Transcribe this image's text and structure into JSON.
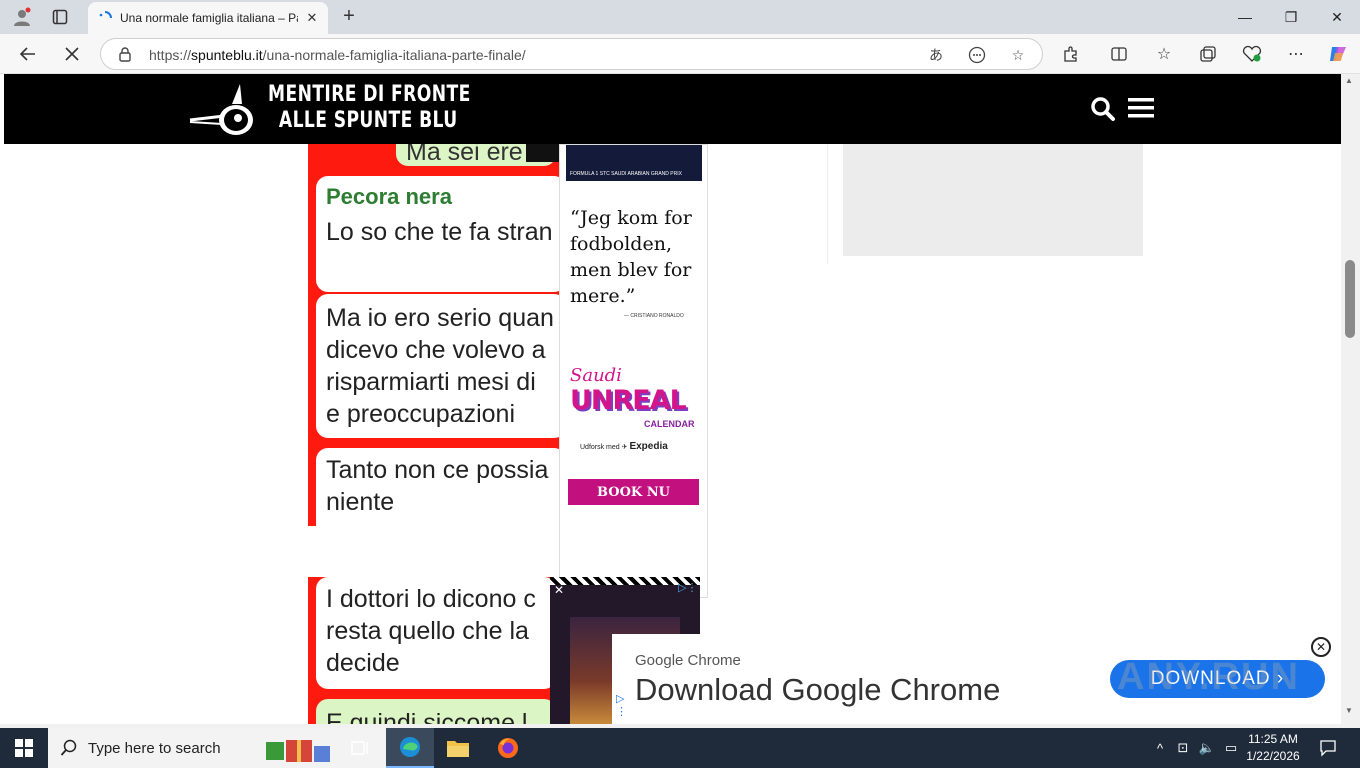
{
  "browser": {
    "tab_title": "Una normale famiglia italiana – Pa",
    "url_prefix": "https://",
    "url_host": "spunteblu.it",
    "url_path": "/una-normale-famiglia-italiana-parte-finale/",
    "window_controls": {
      "minimize": "—",
      "restore": "❐",
      "close": "✕"
    }
  },
  "site": {
    "logo_line1": "MENTIRE DI FRONTE",
    "logo_line2": "ALLE SPUNTE BLU"
  },
  "chat1": {
    "sender": "Pecora nera",
    "top_cut": "Ma sei ere",
    "line1": "Lo so che te fa stran",
    "line2a": "Ma io ero serio quan",
    "line2b": "dicevo che volevo a",
    "line2c": "risparmiarti mesi di",
    "line2d": "e preoccupazioni",
    "line3a": "Tanto non ce possia",
    "line3b": "niente"
  },
  "ad1": {
    "top_caption": "FORMULA 1 STC SAUDI ARABIAN GRAND PRIX",
    "quote": "“Jeg kom for fodbolden, men blev for mere.”",
    "quote_by": "— CRISTIANO RONALDO",
    "brand1": "Saudi",
    "brand2": "UNREAL",
    "brand3": "CALENDAR",
    "partner_prefix": "Udforsk med",
    "partner": "Expedia",
    "cta": "BOOK NU"
  },
  "chat2": {
    "line1": "I dottori lo dicono c",
    "line2": "resta quello che la",
    "line3": "decide",
    "line4": "E quindi siccome l"
  },
  "chrome_ad": {
    "small": "Google Chrome",
    "headline": "Download Google Chrome",
    "button": "DOWNLOAD",
    "watermark": "ANY.RUN"
  },
  "taskbar": {
    "search_placeholder": "Type here to search",
    "time": "11:25 AM",
    "date": "1/22/2026"
  },
  "colors": {
    "chat_red": "#ff1a10",
    "ad_pink": "#c2107e",
    "chrome_blue": "#1a73e8"
  }
}
